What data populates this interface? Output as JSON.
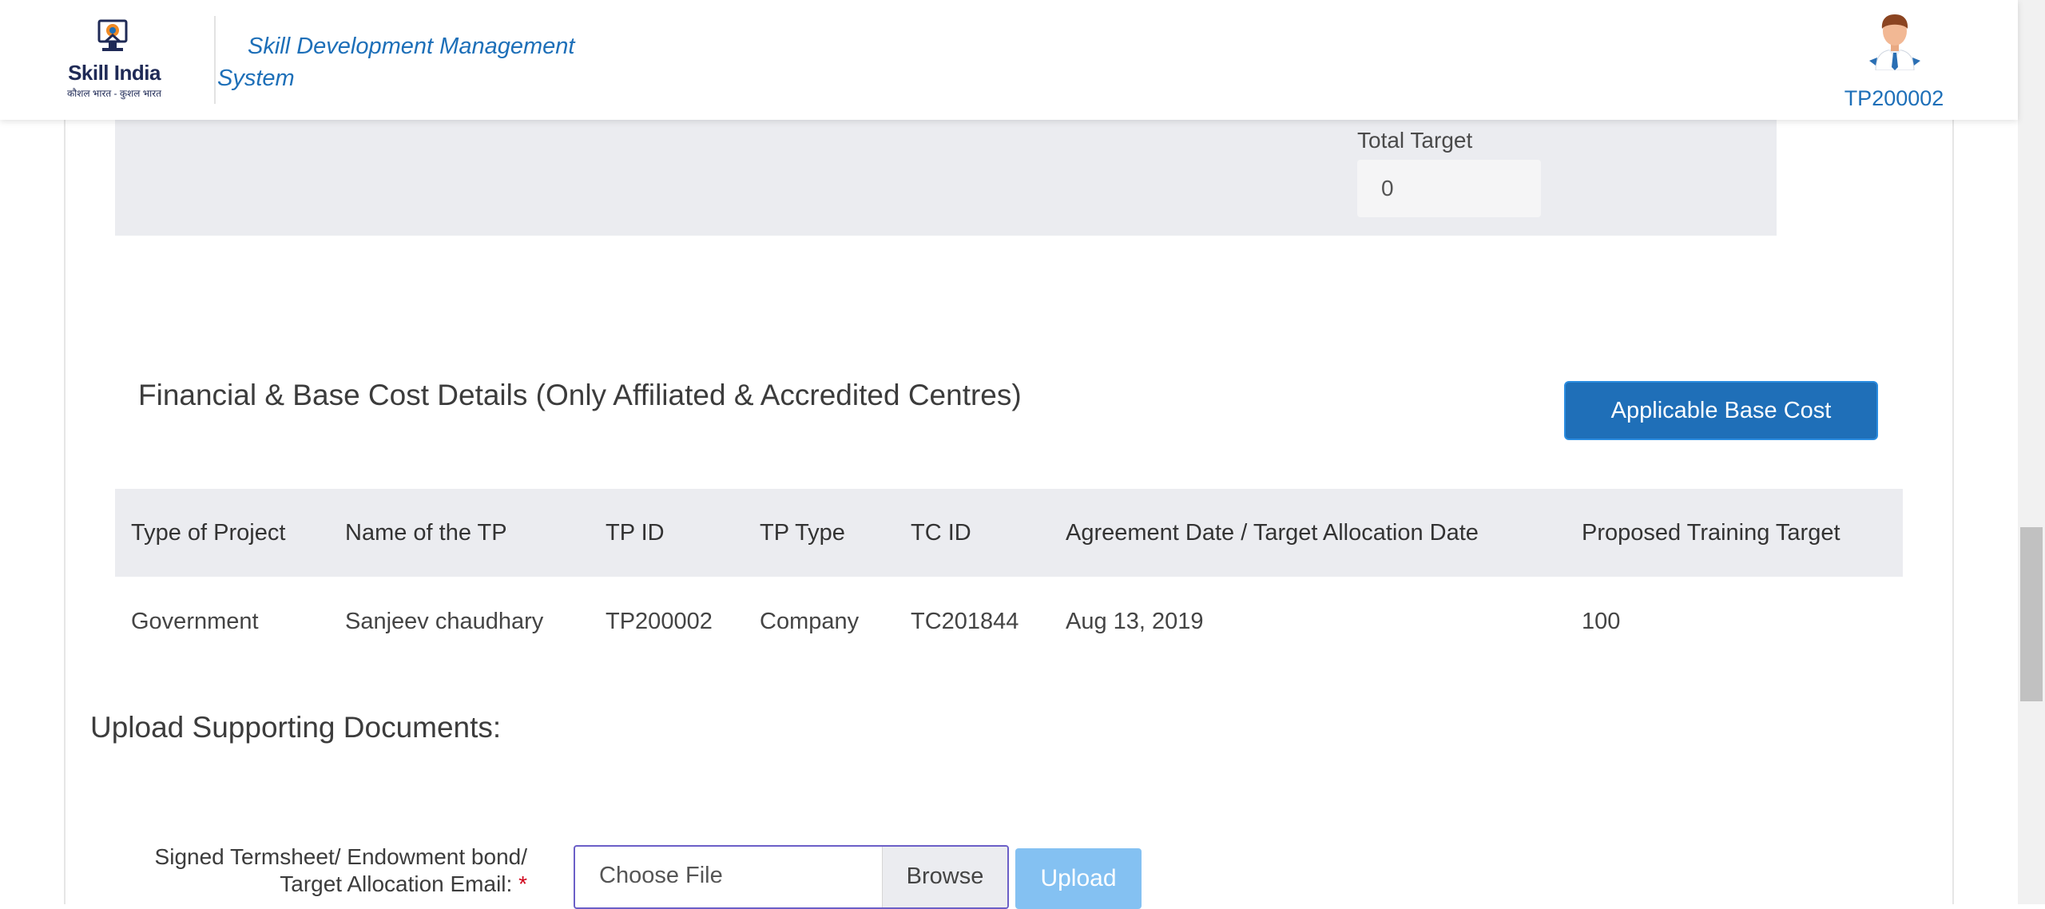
{
  "header": {
    "logo_title": "Skill India",
    "logo_tagline": "कौशल भारत - कुशल भारत",
    "app_title": "Skill Development Management System",
    "user_id": "TP200002"
  },
  "target": {
    "label": "Total Target",
    "value": "0"
  },
  "financial": {
    "title": "Financial & Base Cost Details (Only Affiliated & Accredited Centres)",
    "button_label": "Applicable Base Cost",
    "columns": [
      "Type of Project",
      "Name of the TP",
      "TP ID",
      "TP Type",
      "TC ID",
      "Agreement Date / Target Allocation Date",
      "Proposed Training Target"
    ],
    "rows": [
      [
        "Government",
        "Sanjeev chaudhary",
        "TP200002",
        "Company",
        "TC201844",
        "Aug 13, 2019",
        "100"
      ]
    ]
  },
  "upload": {
    "title": "Upload Supporting Documents:",
    "field_label_line1": "Signed Termsheet/ Endowment bond/",
    "field_label_line2": "Target Allocation Email:",
    "required_mark": "*",
    "file_placeholder": "Choose File",
    "browse_label": "Browse",
    "upload_label": "Upload"
  },
  "colors": {
    "brand_blue": "#1f6fb8",
    "upload_disabled": "#84c1f2",
    "panel_gray": "#ebecf0",
    "required_red": "#d0021b"
  },
  "icons": {
    "logo": "skill-india-logo",
    "avatar": "user-avatar-icon"
  }
}
